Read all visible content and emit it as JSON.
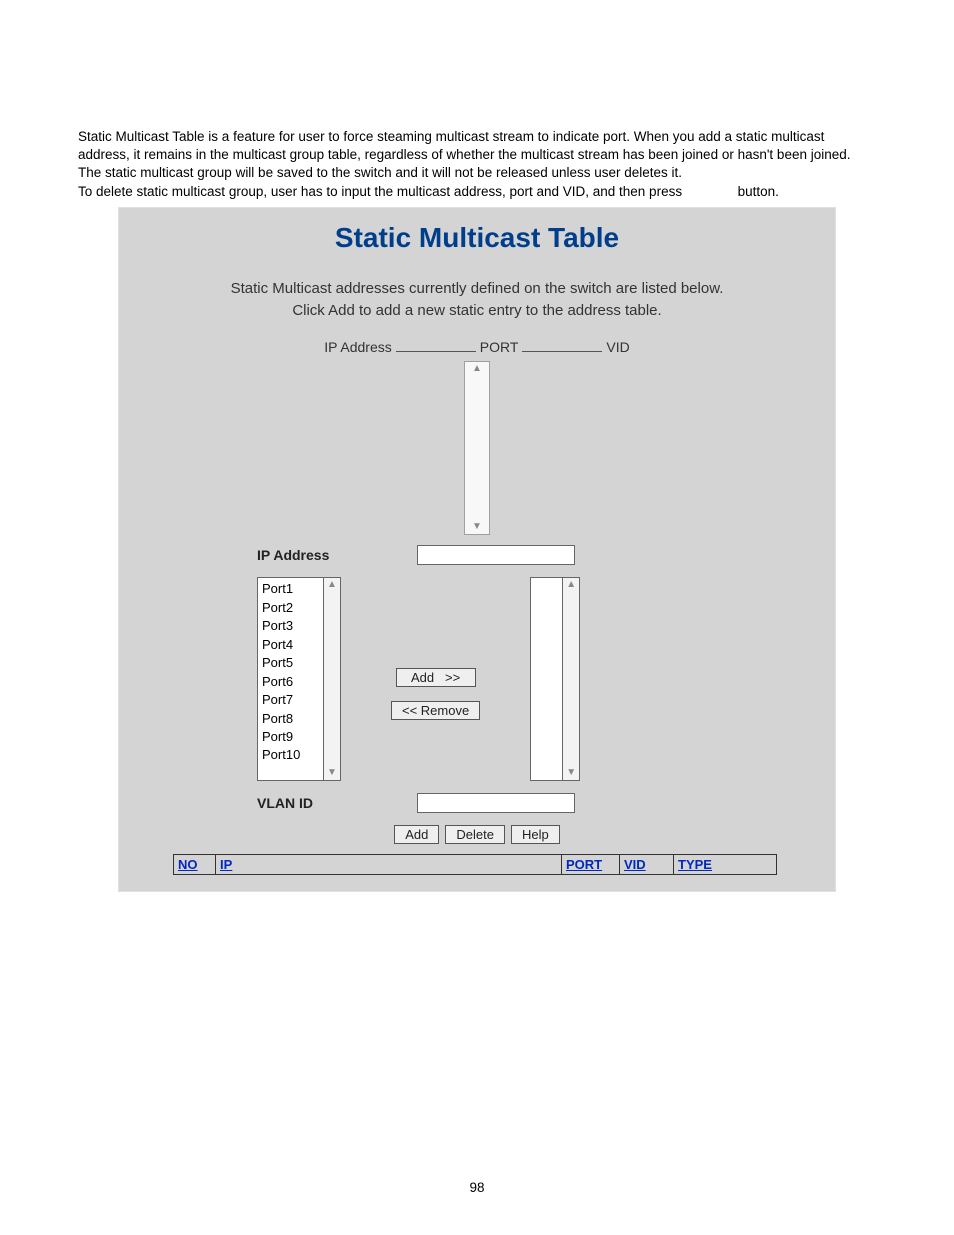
{
  "intro": {
    "line1": "Static Multicast Table is a feature for user to force steaming multicast stream to indicate port. When you add a static multicast address, it remains in the multicast group table, regardless of whether the multicast stream has been joined or hasn't been joined. The static multicast group will be saved to the switch and it will not be released unless user deletes it.",
    "line2_prefix": "To delete static multicast group, user has to input the multicast address, port and VID, and then press",
    "line2_suffix": "button."
  },
  "panel": {
    "title": "Static Multicast Table",
    "subtitle": "Static Multicast addresses currently defined on the switch are listed below.\nClick Add to add a new static entry to the address table.",
    "hdr_ip": "IP Address",
    "hdr_port": "PORT",
    "hdr_vid": "VID",
    "label_ip": "IP Address",
    "label_vlan": "VLAN ID",
    "ports": [
      "Port1",
      "Port2",
      "Port3",
      "Port4",
      "Port5",
      "Port6",
      "Port7",
      "Port8",
      "Port9",
      "Port10"
    ],
    "btn_add_sel": "Add   >>",
    "btn_remove_sel": "<< Remove",
    "btn_add": "Add",
    "btn_delete": "Delete",
    "btn_help": "Help"
  },
  "table_headers": {
    "no": "NO",
    "ip": "IP",
    "port": "PORT",
    "vid": "VID",
    "type": "TYPE"
  },
  "page_number": "98"
}
